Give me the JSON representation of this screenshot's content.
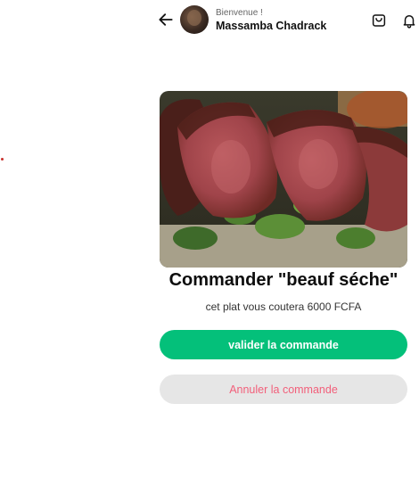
{
  "header": {
    "greeting": "Bienvenue !",
    "user_name": "Massamba Chadrack",
    "icons": [
      "arrow-left-icon",
      "shopping-bag-icon",
      "bell-icon"
    ]
  },
  "order": {
    "title": "Commander \"beauf séche\"",
    "price_text": "cet plat vous coutera 6000 FCFA",
    "confirm_label": "valider la commande",
    "cancel_label": "Annuler la commande"
  },
  "colors": {
    "confirm": "#04c07a",
    "cancel_bg": "#e6e6e6",
    "cancel_text": "#f25f7a"
  }
}
